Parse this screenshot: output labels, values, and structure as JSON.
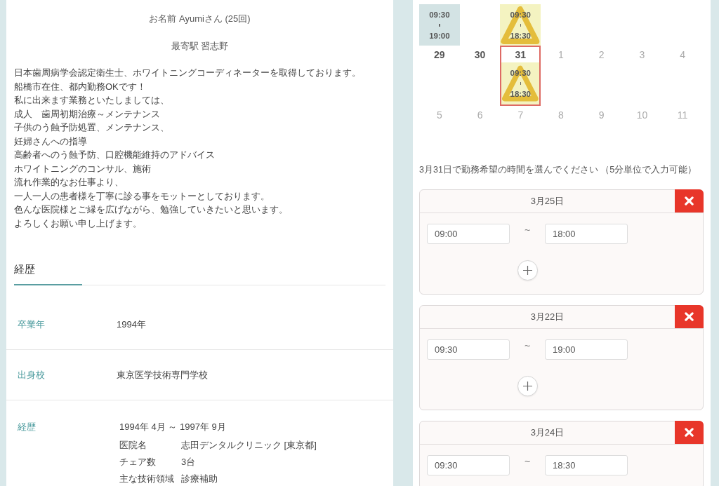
{
  "profile": {
    "name_line": "お名前 Ayumiさん (25回)",
    "station_line": "最寄駅 習志野",
    "bio_lines": [
      "日本歯周病学会認定衛生士、ホワイトニングコーディネーターを取得しております。",
      "船橋市在住、都内勤務OKです！",
      "私に出来ます業務といたしましては、",
      "成人　歯周初期治療～メンテナンス",
      "子供のう蝕予防処置、メンテナンス、",
      "妊婦さんへの指導",
      "高齢者へのう蝕予防、口腔機能維持のアドバイス",
      "ホワイトニングのコンサル、施術",
      "流れ作業的なお仕事より、",
      "一人一人の患者様を丁寧に診る事をモットーとしております。",
      "色んな医院様とご縁を広げながら、勉強していきたいと思います。",
      "よろしくお願い申し上げます。"
    ]
  },
  "section_tabs": [
    {
      "label": "経歴",
      "selected": true
    }
  ],
  "details": [
    {
      "kind": "field",
      "label": "卒業年",
      "value": "1994年"
    },
    {
      "kind": "field",
      "label": "出身校",
      "value": "東京医学技術専門学校"
    },
    {
      "kind": "career",
      "label": "経歴",
      "period": "1994年 4月 ～ 1997年 9月",
      "items": [
        {
          "key": "医院名",
          "value": "志田デンタルクリニック [東京都]"
        },
        {
          "key": "チェア数",
          "value": "3台"
        },
        {
          "key": "主な技術領域",
          "value": "診療補助"
        }
      ]
    }
  ],
  "calendar": {
    "partial_week": [
      {
        "selected": false,
        "slot": {
          "kind": "confirmed",
          "start": "09:30",
          "end": "19:00"
        }
      },
      {
        "selected": false
      },
      {
        "selected": false,
        "slot": {
          "kind": "tentative",
          "start": "09:30",
          "end": "18:30"
        }
      },
      {
        "selected": false
      },
      {
        "selected": false
      },
      {
        "selected": false
      },
      {
        "selected": false
      }
    ],
    "weeks": [
      {
        "days": [
          {
            "number": "29",
            "current_month": true,
            "selected": false
          },
          {
            "number": "30",
            "current_month": true,
            "selected": false
          },
          {
            "number": "31",
            "current_month": true,
            "selected": true,
            "slot": {
              "kind": "tentative",
              "start": "09:30",
              "end": "18:30"
            }
          },
          {
            "number": "1",
            "current_month": false,
            "selected": false
          },
          {
            "number": "2",
            "current_month": false,
            "selected": false
          },
          {
            "number": "3",
            "current_month": false,
            "selected": false
          },
          {
            "number": "4",
            "current_month": false,
            "selected": false
          }
        ]
      },
      {
        "days": [
          {
            "number": "5",
            "current_month": false,
            "selected": false
          },
          {
            "number": "6",
            "current_month": false,
            "selected": false
          },
          {
            "number": "7",
            "current_month": false,
            "selected": false
          },
          {
            "number": "8",
            "current_month": false,
            "selected": false
          },
          {
            "number": "9",
            "current_month": false,
            "selected": false
          },
          {
            "number": "10",
            "current_month": false,
            "selected": false
          },
          {
            "number": "11",
            "current_month": false,
            "selected": false
          }
        ]
      }
    ]
  },
  "instruction": "3月31日で勤務希望の時間を選んでください （5分単位で入力可能）",
  "time_cards": [
    {
      "date": "3月25日",
      "start": "09:00",
      "separator": "~",
      "end": "18:00",
      "add_button": true
    },
    {
      "date": "3月22日",
      "start": "09:30",
      "separator": "~",
      "end": "19:00",
      "add_button": true
    },
    {
      "date": "3月24日",
      "start": "09:30",
      "separator": "~",
      "end": "18:30",
      "add_button": false
    }
  ]
}
